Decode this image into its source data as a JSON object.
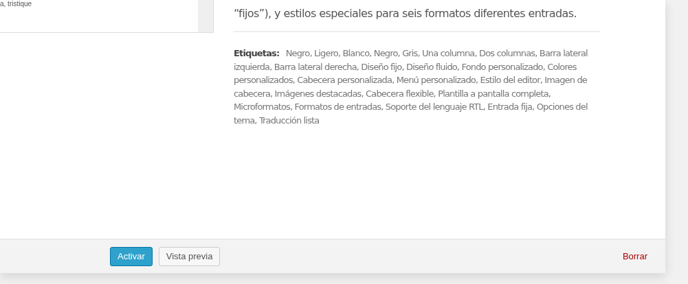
{
  "screenshot": {
    "caption": "a, tristique"
  },
  "description": {
    "lines": [
      "“fijos”), y estilos especiales para seis formatos diferentes entradas."
    ]
  },
  "tags": {
    "label": "Etiquetas:",
    "text": "Negro, Ligero, Blanco, Negro, Gris, Una columna, Dos columnas, Barra lateral izquierda, Barra lateral derecha, Diseño fijo, Diseño fluido, Fondo personalizado, Colores personalizados, Cabecera personalizada, Menú personalizado, Estilo del editor, Imagen de cabecera, Imágenes destacadas, Cabecera flexible, Plantilla a pantalla completa, Microformatos, Formatos de entradas, Soporte del lenguaje RTL, Entrada fija, Opciones del tema, Traducción lista"
  },
  "actions": [
    {
      "kind": "primary",
      "label": "Activar"
    },
    {
      "kind": "secondary",
      "label": "Vista previa"
    },
    {
      "kind": "delete",
      "label": "Borrar"
    }
  ]
}
